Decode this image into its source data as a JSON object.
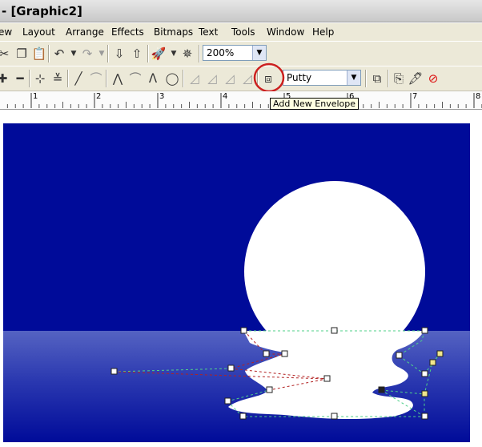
{
  "window": {
    "title": "- [Graphic2]"
  },
  "menu": {
    "items": [
      "ew",
      "Layout",
      "Arrange",
      "Effects",
      "Bitmaps",
      "Text",
      "Tools",
      "Window",
      "Help"
    ]
  },
  "toolbar": {
    "zoom_value": "200%",
    "envelope_mode_value": "Putty"
  },
  "tooltip": {
    "text": "Add New Envelope"
  },
  "ruler": {
    "labels": [
      "1",
      "2",
      "3",
      "4",
      "5",
      "6",
      "7",
      "8"
    ]
  },
  "colors": {
    "sky": "#000b99",
    "water_top": "#5563c2",
    "highlight_circle": "#cc1f1f",
    "envelope_dashed_green": "#4fd08a",
    "envelope_dashed_red": "#b22222"
  }
}
